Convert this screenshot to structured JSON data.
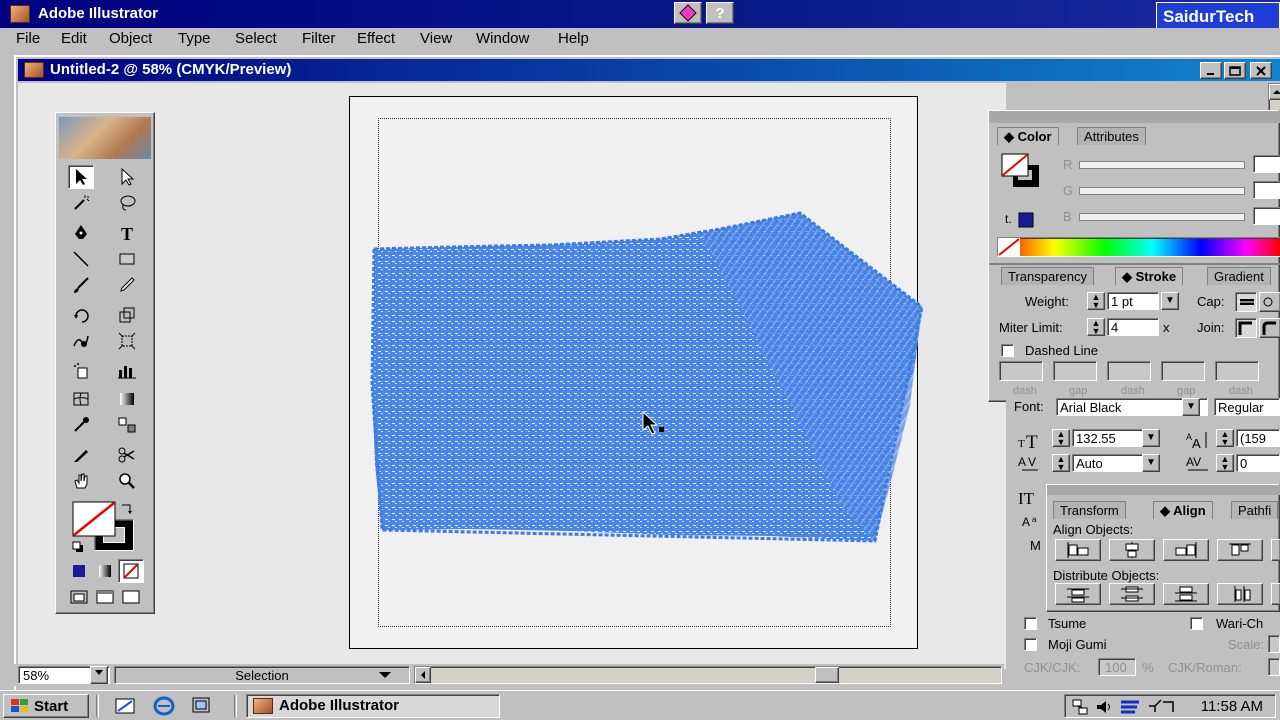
{
  "app": {
    "title": "Adobe Illustrator",
    "brand": "SaidurTech",
    "help_button": "?"
  },
  "menu": {
    "items": [
      "File",
      "Edit",
      "Object",
      "Type",
      "Select",
      "Filter",
      "Effect",
      "View",
      "Window",
      "Help"
    ]
  },
  "document": {
    "title": "Untitled-2 @ 58% (CMYK/Preview)",
    "zoom": "58%",
    "status": "Selection",
    "artwork_color": "#4a86e8"
  },
  "color_panel": {
    "tabs": [
      "Color",
      "Attributes"
    ],
    "labels": [
      "R",
      "G",
      "B"
    ]
  },
  "stroke_panel": {
    "tabs": [
      "Transparency",
      "Stroke",
      "Gradient"
    ],
    "weight_label": "Weight:",
    "weight_value": "1 pt",
    "cap_label": "Cap:",
    "miter_label": "Miter Limit:",
    "miter_value": "4",
    "miter_unit": "x",
    "join_label": "Join:",
    "dashed_label": "Dashed Line",
    "dash_labels": [
      "dash",
      "gap",
      "dash",
      "gap",
      "dash"
    ]
  },
  "character_panel": {
    "font_label": "Font:",
    "font_value": "Arial Black",
    "style_value": "Regular",
    "size_value": "132.55",
    "leading_value": "(159",
    "kerning_value": "Auto",
    "tracking_value": "0"
  },
  "align_panel": {
    "tabs": [
      "Transform",
      "Align",
      "Pathfi"
    ],
    "align_objects_label": "Align Objects:",
    "distribute_label": "Distribute Objects:"
  },
  "cjk_panel": {
    "tsume_label": "Tsume",
    "wari_label": "Wari-Ch",
    "moji_label": "Moji Gumi",
    "scale_label": "Scale:",
    "cjk_label": "CJK/CJK:",
    "cjk_value": "100",
    "cjk_unit": "%",
    "cjk_roman_label": "CJK/Roman:",
    "m_label": "M"
  },
  "taskbar": {
    "start_label": "Start",
    "task_label": "Adobe Illustrator",
    "clock": "11:58 AM"
  }
}
